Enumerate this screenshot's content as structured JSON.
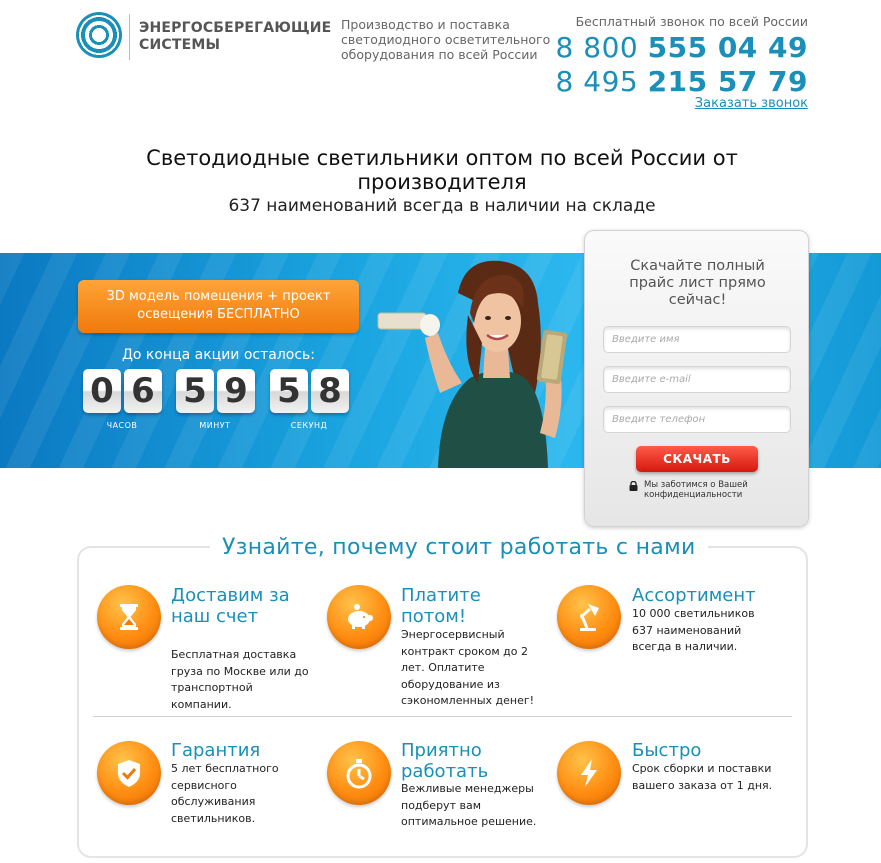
{
  "header": {
    "logo_text": "ЭНЕРГОСБЕРЕГАЮЩИЕ СИСТЕМЫ",
    "tagline": "Производство и поставка светодиодного осветительного оборудования по всей России",
    "phone_note": "Бесплатный звонок по всей России",
    "phone1_prefix": "8 800",
    "phone1_main": "555 04 49",
    "phone2_prefix": "8 495",
    "phone2_main": "215 57 79",
    "callback": "Заказать звонок"
  },
  "hero": {
    "headline": "Светодиодные светильники оптом по всей России от производителя",
    "subheadline": "637 наименований всегда в наличии на складе"
  },
  "promo": {
    "button": "3D модель помещения + проект освещения БЕСПЛАТНО",
    "countdown_label": "До конца акции осталось:",
    "hours": [
      "0",
      "6"
    ],
    "minutes": [
      "5",
      "9"
    ],
    "seconds": [
      "5",
      "8"
    ],
    "hours_label": "ЧАСОВ",
    "minutes_label": "МИНУТ",
    "seconds_label": "СЕКУНД"
  },
  "form": {
    "title": "Скачайте полный прайс лист прямо сейчас!",
    "name_placeholder": "Введите имя",
    "email_placeholder": "Введите e-mail",
    "phone_placeholder": "Введите телефон",
    "submit": "СКАЧАТЬ",
    "privacy": "Мы заботимся о Вашей конфиденциальности"
  },
  "features": {
    "title": "Узнайте, почему стоит работать с нами",
    "items": [
      {
        "icon": "hourglass-icon",
        "title": "Доставим за наш счет",
        "text": "Бесплатная доставка груза по Москве или до транспортной компании."
      },
      {
        "icon": "piggy-bank-icon",
        "title": "Платите потом!",
        "text": "Энергосервисный контракт сроком до 2 лет. Оплатите оборудование из сэкономленных денег!"
      },
      {
        "icon": "desk-lamp-icon",
        "title": "Ассортимент",
        "text": "10 000 светильников 637 наименований всегда в наличии."
      },
      {
        "icon": "shield-check-icon",
        "title": "Гарантия",
        "text": "5 лет бесплатного сервисного обслуживания светильников."
      },
      {
        "icon": "stopwatch-icon",
        "title": "Приятно работать",
        "text": "Вежливые менеджеры подберут вам оптимальное решение."
      },
      {
        "icon": "lightning-icon",
        "title": "Быстро",
        "text": "Срок сборки и поставки вашего заказа от 1 дня."
      }
    ]
  },
  "colors": {
    "accent": "#1a8fb8",
    "orange": "#f07a0a",
    "cta_red": "#d5180e",
    "banner_blue": "#1aa5e0"
  }
}
